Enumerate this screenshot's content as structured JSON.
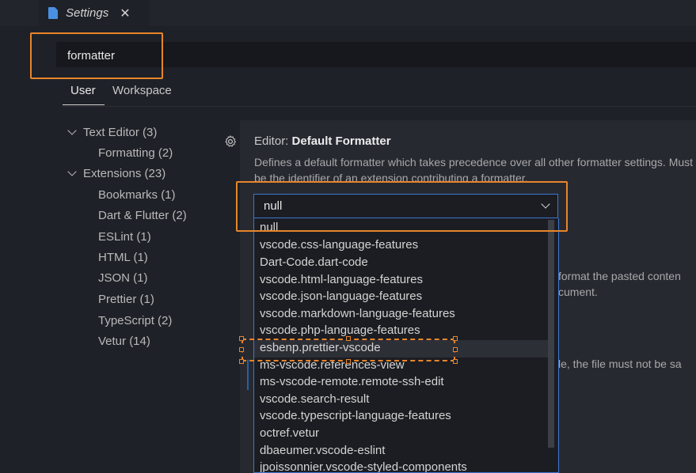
{
  "tab": {
    "title": "Settings",
    "close": "✕"
  },
  "search": {
    "value": "formatter"
  },
  "scope_tabs": {
    "user": "User",
    "workspace": "Workspace"
  },
  "toc": [
    "Text Editor (3)",
    "Formatting (2)",
    "Extensions (23)",
    "Bookmarks (1)",
    "Dart & Flutter (2)",
    "ESLint (1)",
    "HTML (1)",
    "JSON (1)",
    "Prettier (1)",
    "TypeScript (2)",
    "Vetur (14)"
  ],
  "setting": {
    "category": "Editor: ",
    "name": "Default Formatter",
    "description": "Defines a default formatter which takes precedence over all other formatter settings. Must be the identifier of an extension contributing a formatter.",
    "value": "null"
  },
  "dropdown_options": [
    "null",
    "vscode.css-language-features",
    "Dart-Code.dart-code",
    "vscode.html-language-features",
    "vscode.json-language-features",
    "vscode.markdown-language-features",
    "vscode.php-language-features",
    "esbenp.prettier-vscode",
    "ms-vscode.references-view",
    "ms-vscode-remote.remote-ssh-edit",
    "vscode.search-result",
    "vscode.typescript-language-features",
    "octref.vetur",
    "dbaeumer.vscode-eslint",
    "jpoissonnier.vscode-styled-components"
  ],
  "background_text": {
    "line1": "format the pasted conten",
    "line2": "cument.",
    "line3": "le, the file must not be sa"
  },
  "colors": {
    "highlight": "#e8852a",
    "focus_border": "#3c76d1"
  }
}
